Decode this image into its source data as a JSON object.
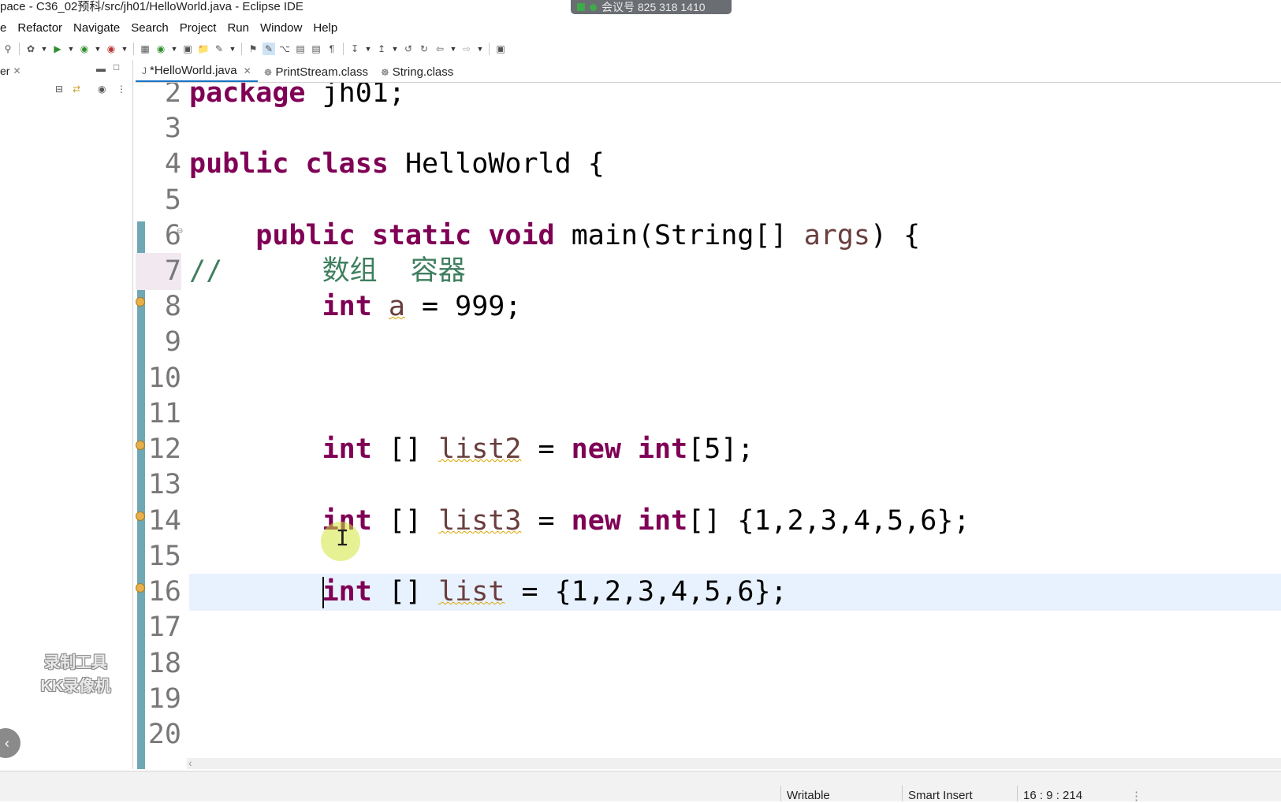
{
  "window": {
    "title": "pace - C36_02预科/src/jh01/HelloWorld.java - Eclipse IDE"
  },
  "meeting_overlay": {
    "text": "会议号 825 318 1410"
  },
  "menu": {
    "items": [
      {
        "label": "e"
      },
      {
        "label": "Refactor"
      },
      {
        "label": "Navigate"
      },
      {
        "label": "Search"
      },
      {
        "label": "Project"
      },
      {
        "label": "Run"
      },
      {
        "label": "Window"
      },
      {
        "label": "Help"
      }
    ]
  },
  "left_panel": {
    "tab_label": "er"
  },
  "editor_tabs": [
    {
      "label": "*HelloWorld.java",
      "active": true
    },
    {
      "label": "PrintStream.class",
      "active": false
    },
    {
      "label": "String.class",
      "active": false
    }
  ],
  "editor": {
    "line_numbers": [
      "2",
      "3",
      "4",
      "5",
      "6",
      "7",
      "8",
      "9",
      "10",
      "11",
      "12",
      "13",
      "14",
      "15",
      "16",
      "17",
      "18",
      "19",
      "20"
    ],
    "current_line": "16",
    "lines": {
      "l2": [
        "package",
        " jh01;"
      ],
      "l4": [
        "public",
        " ",
        "class",
        " HelloWorld {"
      ],
      "l6": [
        "    ",
        "public",
        " ",
        "static",
        " ",
        "void",
        " main(String[] ",
        "args",
        ") {"
      ],
      "l7": [
        "//      数组  容器"
      ],
      "l8": [
        "        ",
        "int",
        " ",
        "a",
        " = 999;"
      ],
      "l12": [
        "        ",
        "int",
        " [] ",
        "list2",
        " = ",
        "new",
        " ",
        "int",
        "[5];"
      ],
      "l14": [
        "        ",
        "int",
        " [] ",
        "list3",
        " = ",
        "new",
        " ",
        "int",
        "[] {1,2,3,4,5,6};"
      ],
      "l16": [
        "        ",
        "int",
        " [] ",
        "list",
        " = {1,2,3,4,5,6};"
      ]
    }
  },
  "watermark": {
    "line1": "录制工具",
    "line2": "KK录像机"
  },
  "statusbar": {
    "writable": "Writable",
    "insert_mode": "Smart Insert",
    "position": "16 : 9 : 214"
  },
  "colors": {
    "keyword": "#7f0055",
    "comment": "#3f7f5f",
    "variable": "#6a3e3e",
    "current_line": "#e8f2fe",
    "change_ruler": "#6fa8b4"
  }
}
